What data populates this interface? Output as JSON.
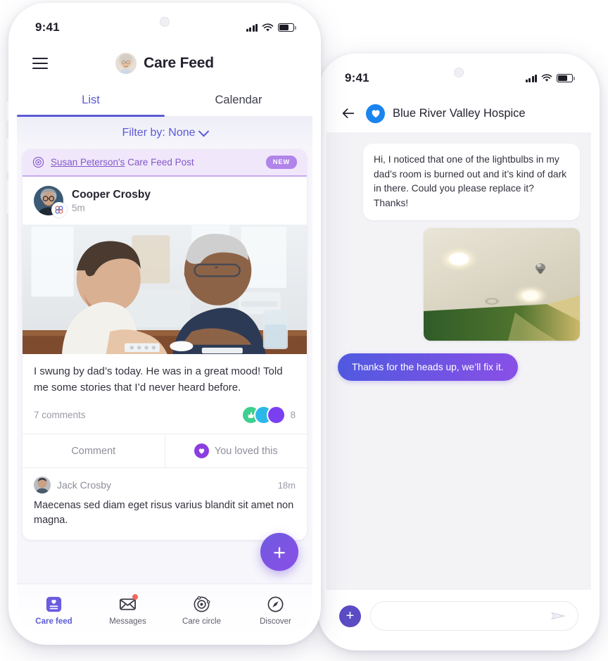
{
  "colors": {
    "accent_purple": "#5b5bd6",
    "brand_violet": "#8b3ee0",
    "ribbon_bg": "#f0e7fb",
    "ribbon_text": "#8457c9",
    "badge_new_bg": "#b084e8",
    "hospice_blue": "#1a84ee",
    "notification_red": "#f4675f",
    "feed_bg": "#f6f6fb",
    "chat_bg": "#f3f3f6",
    "reaction_green": "#3ecf8e",
    "reaction_cyan": "#2bb8e8",
    "reaction_purple": "#7b3ff2"
  },
  "left_phone": {
    "status": {
      "time": "9:41",
      "signal_icon": "signal-bars-icon",
      "wifi_icon": "wifi-icon",
      "battery_icon": "battery-icon"
    },
    "header": {
      "menu_icon": "hamburger-menu-icon",
      "title": "Care Feed",
      "avatar_icon": "profile-avatar-icon"
    },
    "tabs": [
      {
        "label": "List",
        "active": true
      },
      {
        "label": "Calendar",
        "active": false
      }
    ],
    "filter": {
      "label": "Filter by: None",
      "chevron_icon": "chevron-down-icon"
    },
    "post": {
      "ribbon": {
        "icon": "care-circle-icon",
        "owner": "Susan Peterson's",
        "suffix": " Care Feed Post",
        "badge": "NEW"
      },
      "author": "Cooper Crosby",
      "time": "5m",
      "avatar_icon": "author-avatar-icon",
      "avatar_badge_icon": "care-circle-badge-icon",
      "photo_alt": "young-man-helping-elderly-man-with-medication",
      "text": "I swung by dad’s today. He was in a great mood! Told me some stories that I’d never heard before.",
      "comments_label": "7 comments",
      "reaction_count": "8",
      "actions": [
        {
          "label": "Comment",
          "icon": null
        },
        {
          "label": "You loved this",
          "icon": "heart-icon"
        }
      ],
      "comment": {
        "avatar_icon": "commenter-avatar-icon",
        "name": "Jack Crosby",
        "time": "18m",
        "text": "Maecenas sed diam eget risus varius blandit sit amet non magna."
      }
    },
    "fab": {
      "icon": "plus-icon",
      "label": "+"
    },
    "bottom_nav": [
      {
        "label": "Care feed",
        "icon": "care-feed-icon",
        "active": true,
        "badge": false
      },
      {
        "label": "Messages",
        "icon": "envelope-icon",
        "active": false,
        "badge": true
      },
      {
        "label": "Care circle",
        "icon": "care-circle-icon",
        "active": false,
        "badge": false
      },
      {
        "label": "Discover",
        "icon": "compass-icon",
        "active": false,
        "badge": false
      }
    ]
  },
  "right_phone": {
    "status": {
      "time": "9:41",
      "signal_icon": "signal-bars-icon",
      "wifi_icon": "wifi-icon",
      "battery_icon": "battery-icon"
    },
    "header": {
      "back_icon": "back-arrow-icon",
      "logo_icon": "heart-logo-icon",
      "title": "Blue River Valley Hospice"
    },
    "messages": [
      {
        "direction": "incoming",
        "text": "Hi, I noticed that one of the lightbulbs in my dad’s room is burned out and it’s kind of dark in there. Could you please replace it? Thanks!"
      },
      {
        "direction": "incoming",
        "type": "image",
        "alt": "ceiling-with-recessed-lights-one-burned-out"
      },
      {
        "direction": "outgoing",
        "text": "Thanks for the heads up, we’ll fix it."
      }
    ],
    "composer": {
      "plus_icon": "plus-icon",
      "placeholder": "",
      "value": "",
      "send_icon": "send-icon"
    }
  }
}
